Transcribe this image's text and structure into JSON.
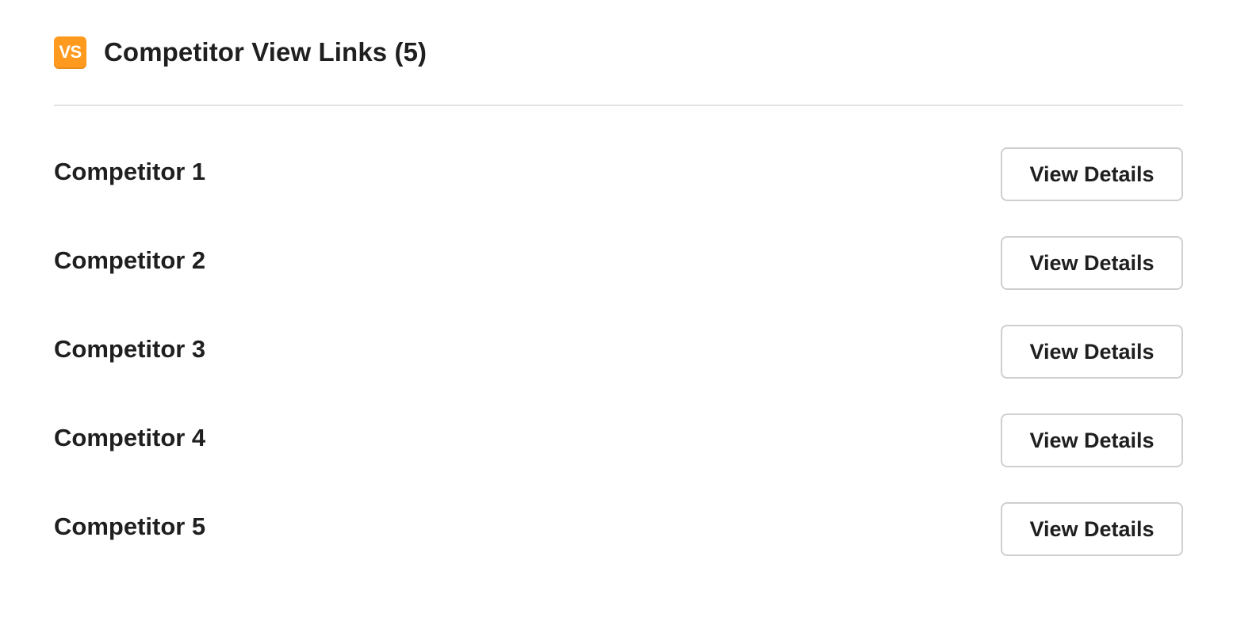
{
  "section": {
    "icon_label": "VS",
    "icon": "vs-icon",
    "title": "Competitor View Links (5)",
    "accent_color": "#ff9a1f"
  },
  "competitors": [
    {
      "name": "Competitor 1",
      "button_label": "View Details"
    },
    {
      "name": "Competitor 2",
      "button_label": "View Details"
    },
    {
      "name": "Competitor 3",
      "button_label": "View Details"
    },
    {
      "name": "Competitor 4",
      "button_label": "View Details"
    },
    {
      "name": "Competitor 5",
      "button_label": "View Details"
    }
  ]
}
